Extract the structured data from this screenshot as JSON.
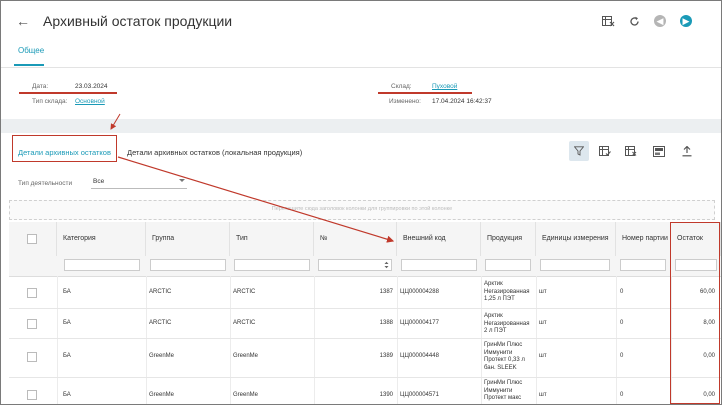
{
  "header": {
    "title": "Архивный остаток продукции"
  },
  "tabs": {
    "general": "Общее"
  },
  "form": {
    "date_label": "Дата:",
    "date_value": "23.03.2024",
    "warehouse_type_label": "Тип склада:",
    "warehouse_type_value": "Основной",
    "warehouse_label": "Склад:",
    "warehouse_value": "Пуховой",
    "changed_label": "Изменено:",
    "changed_value": "17.04.2024 16:42:37"
  },
  "details": {
    "tab_archive": "Детали архивных остатков",
    "tab_local": "Детали архивных остатков (локальная продукция)"
  },
  "activity": {
    "label": "Тип деятельности",
    "value": "Все"
  },
  "group_panel": {
    "text": "Перетащите сюда заголовок колонки для группировки по этой колонке"
  },
  "table": {
    "headers": {
      "category": "Категория",
      "group": "Группа",
      "type": "Тип",
      "number": "№",
      "external_code": "Внешний код",
      "product": "Продукция",
      "unit": "Единицы измерения",
      "batch": "Номер партии",
      "remainder": "Остаток"
    },
    "rows": [
      {
        "category": "БА",
        "group": "ARCTIC",
        "type": "ARCTIC",
        "number": "1387",
        "external_code": "ЦЦ000004288",
        "product": "Арктик Негазированная 1,25 л ПЭТ",
        "unit": "шт",
        "batch": "0",
        "remainder": "60,00"
      },
      {
        "category": "БА",
        "group": "ARCTIC",
        "type": "ARCTIC",
        "number": "1388",
        "external_code": "ЦЦ000004177",
        "product": "Арктик Негазированная 2 л ПЭТ",
        "unit": "шт",
        "batch": "0",
        "remainder": "8,00"
      },
      {
        "category": "БА",
        "group": "GreenMe",
        "type": "GreenMe",
        "number": "1389",
        "external_code": "ЦЦ000004448",
        "product": "ГринМи Плюс Иммунити Протект 0,33 л бан. SLEEK",
        "unit": "шт",
        "batch": "0",
        "remainder": "0,00"
      },
      {
        "category": "БА",
        "group": "GreenMe",
        "type": "GreenMe",
        "number": "1390",
        "external_code": "ЦЦ000004571",
        "product": "ГринМи Плюс Иммунити Протект макс",
        "unit": "шт",
        "batch": "0",
        "remainder": "0,00"
      }
    ]
  },
  "colors": {
    "accent": "#1a9ab7",
    "annotation": "#c0392b"
  }
}
